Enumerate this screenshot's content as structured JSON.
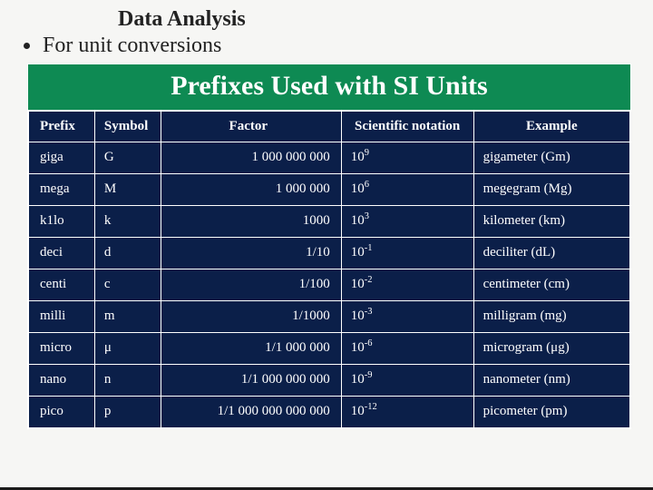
{
  "slide": {
    "title": "Data Analysis",
    "bullet": "For unit conversions"
  },
  "table": {
    "title": "Prefixes Used with SI Units",
    "headers": {
      "prefix": "Prefix",
      "symbol": "Symbol",
      "factor": "Factor",
      "sci": "Scientific notation",
      "example": "Example"
    },
    "rows": [
      {
        "prefix": "giga",
        "symbol": "G",
        "factor": "1 000 000 000",
        "sci_base": "10",
        "sci_exp": "9",
        "example": "gigameter (Gm)"
      },
      {
        "prefix": "mega",
        "symbol": "M",
        "factor": "1 000 000",
        "sci_base": "10",
        "sci_exp": "6",
        "example": "megegram (Mg)"
      },
      {
        "prefix": "k1lo",
        "symbol": "k",
        "factor": "1000",
        "sci_base": "10",
        "sci_exp": "3",
        "example": "kilometer (km)"
      },
      {
        "prefix": "deci",
        "symbol": "d",
        "factor": "1/10",
        "sci_base": "10",
        "sci_exp": "-1",
        "example": "deciliter (dL)"
      },
      {
        "prefix": "centi",
        "symbol": "c",
        "factor": "1/100",
        "sci_base": "10",
        "sci_exp": "-2",
        "example": "centimeter (cm)"
      },
      {
        "prefix": "milli",
        "symbol": "m",
        "factor": "1/1000",
        "sci_base": "10",
        "sci_exp": "-3",
        "example": "milligram (mg)"
      },
      {
        "prefix": "micro",
        "symbol": "μ",
        "factor": "1/1 000 000",
        "sci_base": "10",
        "sci_exp": "-6",
        "example": "microgram (μg)"
      },
      {
        "prefix": "nano",
        "symbol": "n",
        "factor": "1/1 000 000 000",
        "sci_base": "10",
        "sci_exp": "-9",
        "example": "nanometer (nm)"
      },
      {
        "prefix": "pico",
        "symbol": "p",
        "factor": "1/1 000 000 000 000",
        "sci_base": "10",
        "sci_exp": "-12",
        "example": "picometer (pm)"
      }
    ]
  }
}
